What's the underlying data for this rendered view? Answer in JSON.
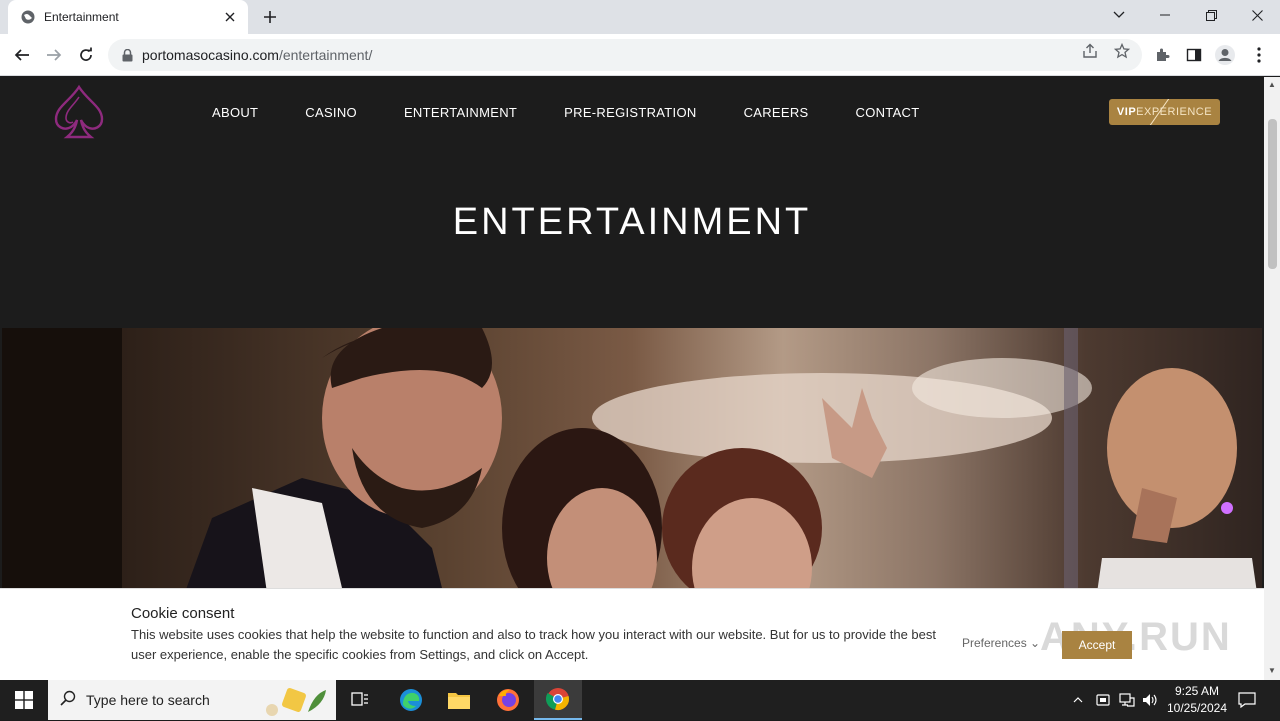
{
  "browser": {
    "tab_title": "Entertainment",
    "url_domain": "portomasocasino.com",
    "url_path": "/entertainment/"
  },
  "site": {
    "nav": [
      "ABOUT",
      "CASINO",
      "ENTERTAINMENT",
      "PRE-REGISTRATION",
      "CAREERS",
      "CONTACT"
    ],
    "vip_bold": "VIP",
    "vip_rest": "EXPERIENCE",
    "hero_title": "ENTERTAINMENT",
    "brand_color": "#a98341",
    "logo_color": "#8e2a7e"
  },
  "cookie": {
    "title": "Cookie consent",
    "text": "This website uses cookies that help the website to function and also to track how you interact with our website. But for us to provide the best user experience, enable the specific cookies from Settings, and click on Accept.",
    "preferences": "Preferences",
    "accept": "Accept",
    "watermark": "ANY.RUN"
  },
  "taskbar": {
    "search_placeholder": "Type here to search",
    "time": "9:25 AM",
    "date": "10/25/2024"
  }
}
